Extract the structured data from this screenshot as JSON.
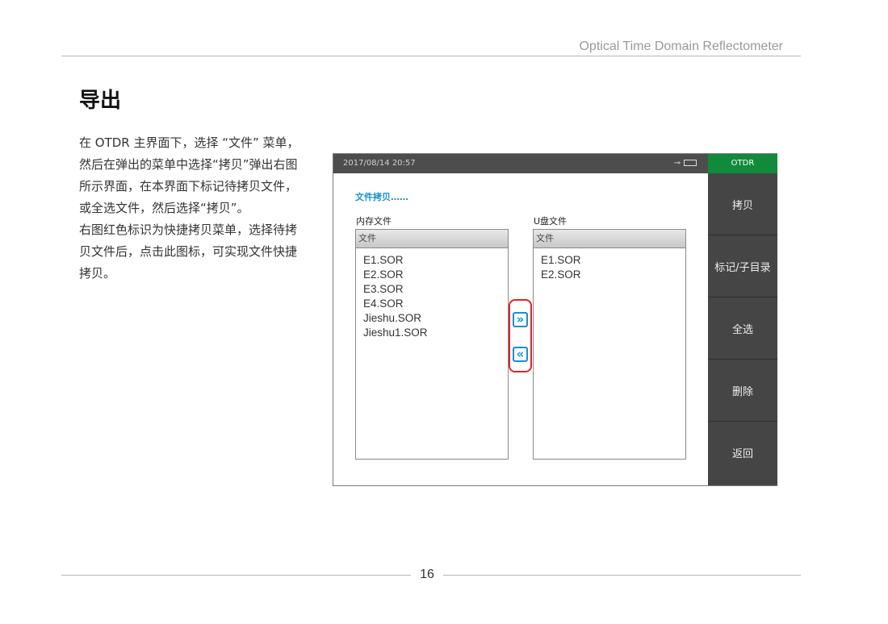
{
  "header": {
    "doc_title": "Optical Time Domain Reflectometer"
  },
  "section": {
    "title": "导出",
    "paragraphs": [
      "在 OTDR 主界面下，选择 “文件” 菜单，然后在弹出的菜单中选择“拷贝”弹出右图所示界面，在本界面下标记待拷贝文件，或全选文件，然后选择“拷贝”。",
      "右图红色标识为快捷拷贝菜单，选择待拷贝文件后，点击此图标，可实现文件快捷拷贝。"
    ]
  },
  "device": {
    "datetime": "2017/08/14  20:57",
    "mode": "OTDR",
    "copy_title": "文件拷贝……",
    "left_label": "内存文件",
    "right_label": "U盘文件",
    "left_head": "文件",
    "right_head": "文件",
    "left_files": [
      "E1.SOR",
      "E2.SOR",
      "E3.SOR",
      "E4.SOR",
      "Jieshu.SOR",
      "Jieshu1.SOR"
    ],
    "right_files": [
      "E1.SOR",
      "E2.SOR"
    ],
    "copy_right_glyph": "»",
    "copy_left_glyph": "«",
    "menu": [
      "拷贝",
      "标记/子目录",
      "全选",
      "删除",
      "返回"
    ],
    "accent_color": "#1a8fd1",
    "mode_color": "#118a3c",
    "highlight_color": "#d9262c"
  },
  "footer": {
    "page_number": "16"
  }
}
